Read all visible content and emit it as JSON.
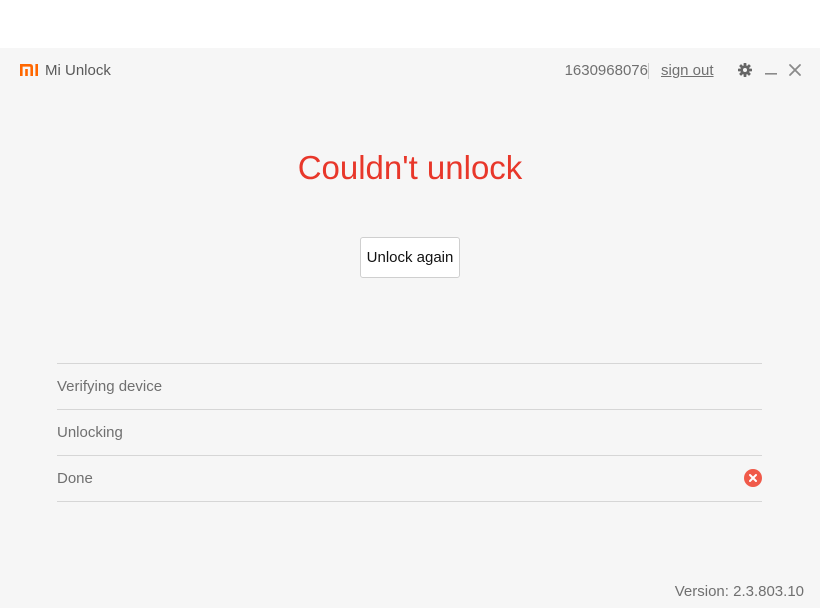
{
  "app": {
    "title": "Mi Unlock",
    "account_id": "1630968076",
    "sign_out_label": "sign out",
    "brand_color": "#ff6700"
  },
  "titlebar_icons": [
    "gear-icon",
    "minimize-icon",
    "close-icon"
  ],
  "main": {
    "headline": "Couldn't unlock",
    "headline_color": "#e8372a",
    "unlock_again_label": "Unlock again"
  },
  "steps": [
    {
      "label": "Verifying device",
      "status": ""
    },
    {
      "label": "Unlocking",
      "status": ""
    },
    {
      "label": "Done",
      "status": "error"
    }
  ],
  "status_colors": {
    "error": "#f05a4a"
  },
  "footer": {
    "version": "Version: 2.3.803.10"
  }
}
